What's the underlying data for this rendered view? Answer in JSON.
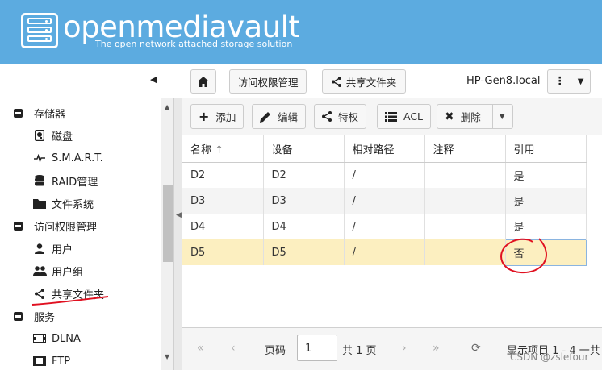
{
  "header": {
    "brand": "openmediavault",
    "tagline": "The open network attached storage solution"
  },
  "topbar": {
    "breadcrumb_1": "访问权限管理",
    "breadcrumb_2": "共享文件夹",
    "hostname": "HP-Gen8.local"
  },
  "sidebar": {
    "items": [
      {
        "label": "存储器",
        "type": "group"
      },
      {
        "label": "磁盘",
        "icon": "disk-icon"
      },
      {
        "label": "S.M.A.R.T.",
        "icon": "pulse-icon"
      },
      {
        "label": "RAID管理",
        "icon": "database-icon"
      },
      {
        "label": "文件系统",
        "icon": "folder-icon"
      },
      {
        "label": "访问权限管理",
        "type": "group"
      },
      {
        "label": "用户",
        "icon": "user-icon"
      },
      {
        "label": "用户组",
        "icon": "users-icon"
      },
      {
        "label": "共享文件夹",
        "icon": "share-icon"
      },
      {
        "label": "服务",
        "type": "group"
      },
      {
        "label": "DLNA",
        "icon": "film-icon"
      },
      {
        "label": "FTP",
        "icon": "film-icon"
      }
    ]
  },
  "actions": {
    "add": "添加",
    "edit": "编辑",
    "privileges": "特权",
    "acl": "ACL",
    "delete": "删除"
  },
  "table": {
    "columns": [
      "名称",
      "设备",
      "相对路径",
      "注释",
      "引用"
    ],
    "rows": [
      {
        "name": "D2",
        "device": "D2",
        "path": "/",
        "comment": "",
        "ref": "是"
      },
      {
        "name": "D3",
        "device": "D3",
        "path": "/",
        "comment": "",
        "ref": "是"
      },
      {
        "name": "D4",
        "device": "D4",
        "path": "/",
        "comment": "",
        "ref": "是"
      },
      {
        "name": "D5",
        "device": "D5",
        "path": "/",
        "comment": "",
        "ref": "否"
      }
    ]
  },
  "pager": {
    "page_label": "页码",
    "page_value": "1",
    "total": "共 1 页",
    "display": "显示项目 1 - 4 一共"
  },
  "watermark": "CSDN @zslefour",
  "colors": {
    "header_bg": "#5cabe0",
    "selected_row": "#fcefc0",
    "annotation": "#e01020"
  }
}
